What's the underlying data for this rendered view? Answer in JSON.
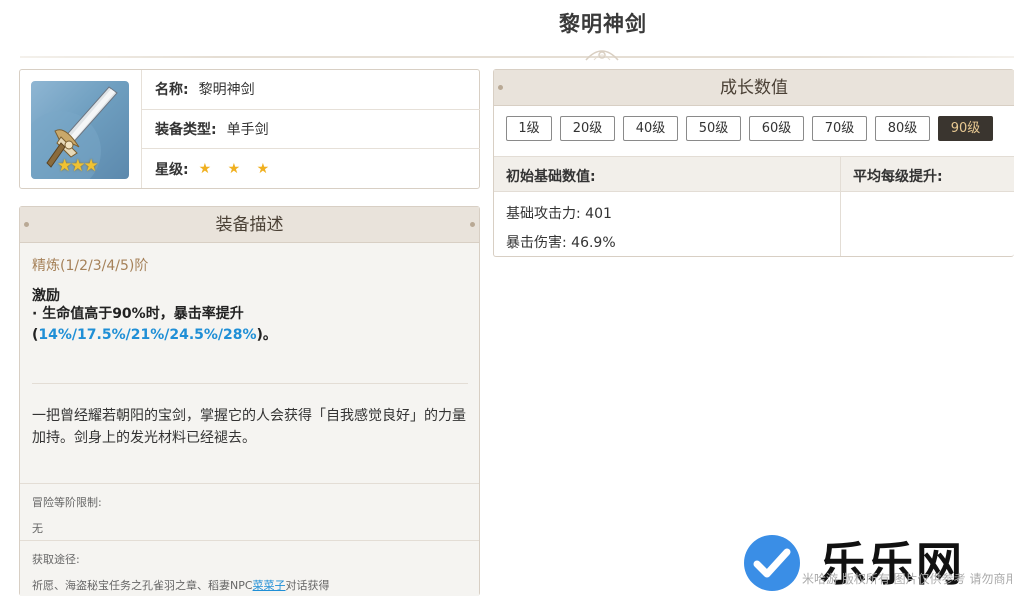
{
  "page": {
    "title": "黎明神剑"
  },
  "info": {
    "name_label": "名称:",
    "name_value": "黎明神剑",
    "type_label": "装备类型:",
    "type_value": "单手剑",
    "rarity_label": "星级:",
    "rarity_stars": "★ ★ ★",
    "thumb_stars": "★★★"
  },
  "description": {
    "title": "装备描述",
    "refine": "精炼(1/2/3/4/5)阶",
    "passive_name": "激励",
    "passive_prefix": "· 生命值高于90%时，暴击率提升(",
    "passive_values": "14%/17.5%/21%/24.5%/28%",
    "passive_suffix": ")。",
    "lore": "一把曾经耀若朝阳的宝剑，掌握它的人会获得「自我感觉良好」的力量加持。剑身上的发光材料已经褪去。",
    "adventure_label": "冒险等阶限制:",
    "adventure_value": "无",
    "source_label": "获取途径:",
    "source_prefix": "祈愿、海盗秘宝任务之孔雀羽之章、稻妻NPC",
    "source_npc": "菜菜子",
    "source_suffix": "对话获得"
  },
  "growth": {
    "title": "成长数值",
    "levels": [
      "1级",
      "20级",
      "40级",
      "50级",
      "60级",
      "70级",
      "80级",
      "90级"
    ],
    "active_level": "90级",
    "col_base": "初始基础数值:",
    "col_avg": "平均每级提升:",
    "base_attack": "基础攻击力: 401",
    "crit_damage": "暴击伤害: 46.9%"
  },
  "watermark": {
    "brand": "乐乐网",
    "small": "米哈游 版权所有 图片仅供参考 请勿商用"
  },
  "colors": {
    "panel_header": "#e9e3db",
    "highlight_blue": "#1f8fd6",
    "refine_gold": "#a6825a",
    "active_level_bg": "#3a352f",
    "star": "#f0b020"
  }
}
